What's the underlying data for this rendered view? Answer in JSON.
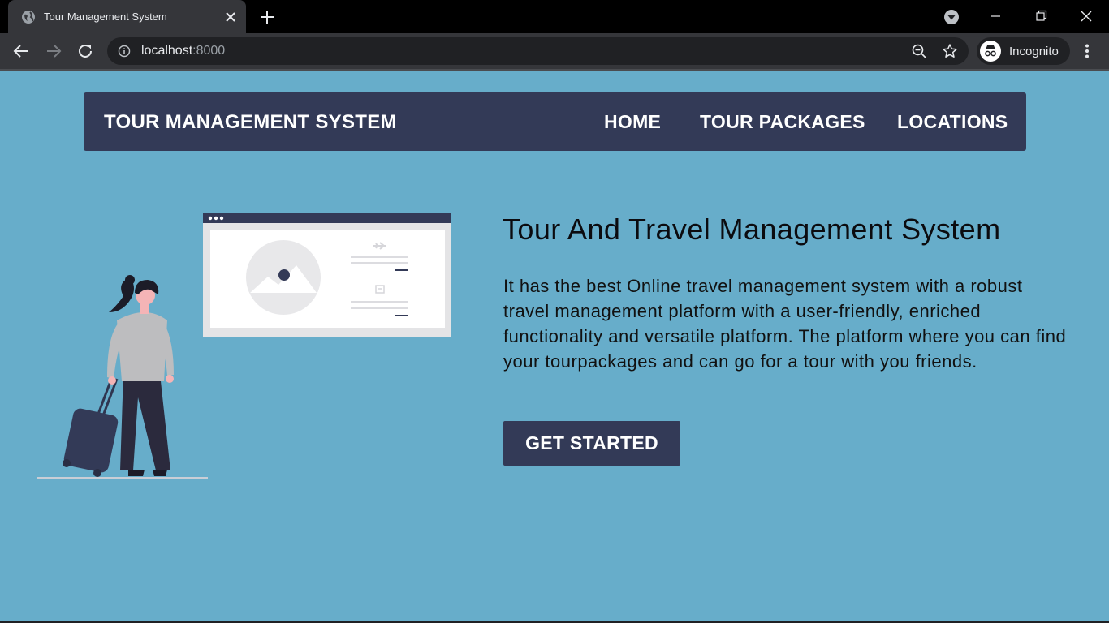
{
  "browser": {
    "tab_title": "Tour Management System",
    "url_host": "localhost",
    "url_port": ":8000",
    "profile_label": "Incognito"
  },
  "nav": {
    "brand": "TOUR MANAGEMENT SYSTEM",
    "links": [
      "HOME",
      "TOUR PACKAGES",
      "LOCATIONS"
    ]
  },
  "hero": {
    "title": "Tour And Travel Management System",
    "description": "It has the best Online travel management system with a robust travel management platform with a user-friendly, enriched functionality and versatile platform. The platform where you can find your tourpackages and can go for a tour with you friends.",
    "cta_label": "GET STARTED"
  },
  "colors": {
    "page_background": "#67adca",
    "navbar": "#333a57",
    "button": "#333a57",
    "chrome_dark": "#35363a"
  }
}
